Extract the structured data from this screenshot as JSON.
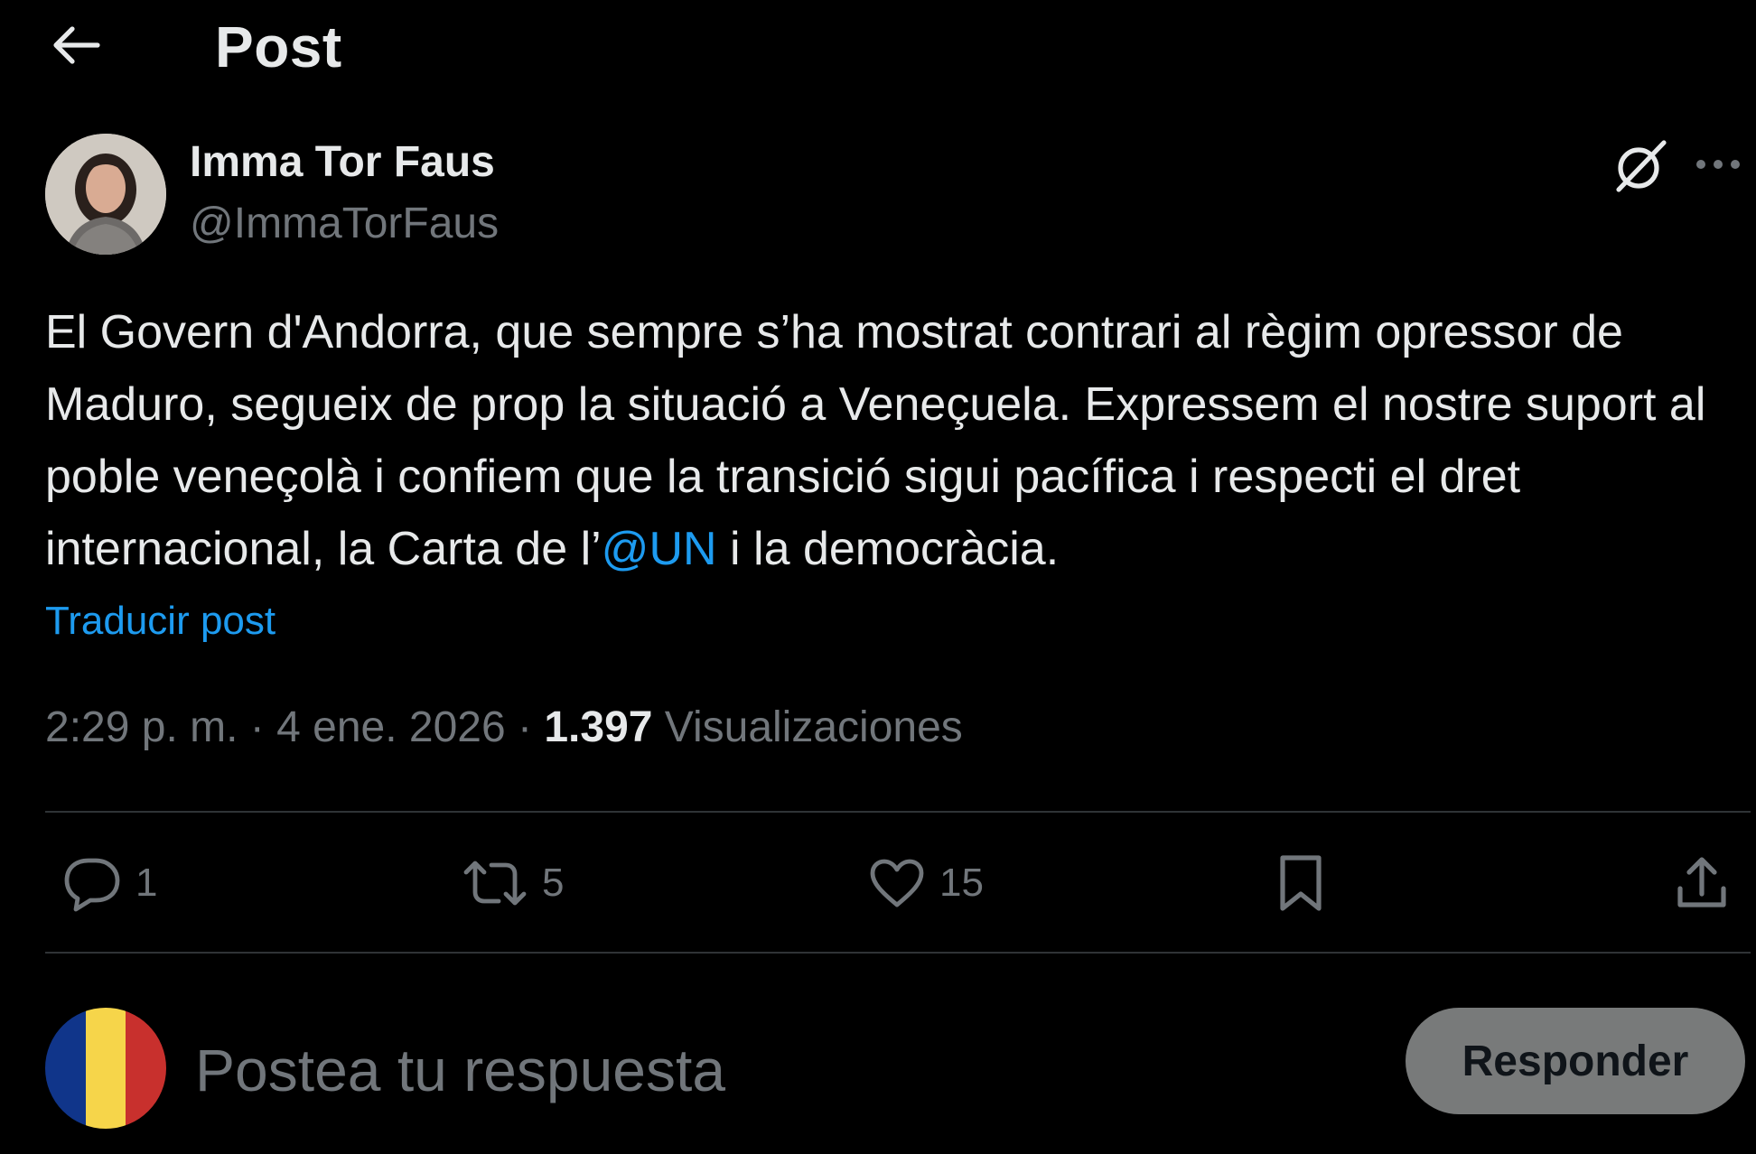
{
  "header": {
    "back_icon": "arrow-left-icon",
    "title": "Post"
  },
  "author": {
    "name": "Imma Tor Faus",
    "handle": "@ImmaTorFaus",
    "avatar_icon": "profile-photo"
  },
  "top_actions": {
    "grok_icon": "grok-icon",
    "more_icon": "more-horizontal-icon"
  },
  "post": {
    "text_before_mention": "El Govern d'Andorra, que sempre s’ha mostrat contrari al règim opressor de Maduro, segueix de prop la situació a Veneçuela. Expressem el nostre suport al poble veneçolà i confiem que la transició sigui pacífica i respecti el dret internacional, la Carta de l’",
    "mention": "@UN",
    "text_after_mention": " i la democràcia.",
    "translate_label": "Traducir post"
  },
  "meta": {
    "time": "2:29 p. m.",
    "separator": " · ",
    "date": "4 ene. 2026",
    "views_count": "1.397",
    "views_label": " Visualizaciones"
  },
  "actions": {
    "reply": {
      "icon": "reply-icon",
      "count": "1"
    },
    "repost": {
      "icon": "repost-icon",
      "count": "5"
    },
    "like": {
      "icon": "heart-icon",
      "count": "15"
    },
    "bookmark": {
      "icon": "bookmark-icon"
    },
    "share": {
      "icon": "share-icon"
    }
  },
  "composer": {
    "avatar_icon": "andorra-flag-avatar",
    "placeholder": "Postea tu respuesta",
    "button_label": "Responder"
  },
  "colors": {
    "background": "#000000",
    "text": "#e7e9ea",
    "secondary": "#71767b",
    "accent": "#1d9bf0",
    "divider": "#2f3336",
    "reply_button_bg": "#787a7a",
    "flag_blue": "#10358a",
    "flag_yellow": "#f6d54a",
    "flag_red": "#c8302d"
  }
}
